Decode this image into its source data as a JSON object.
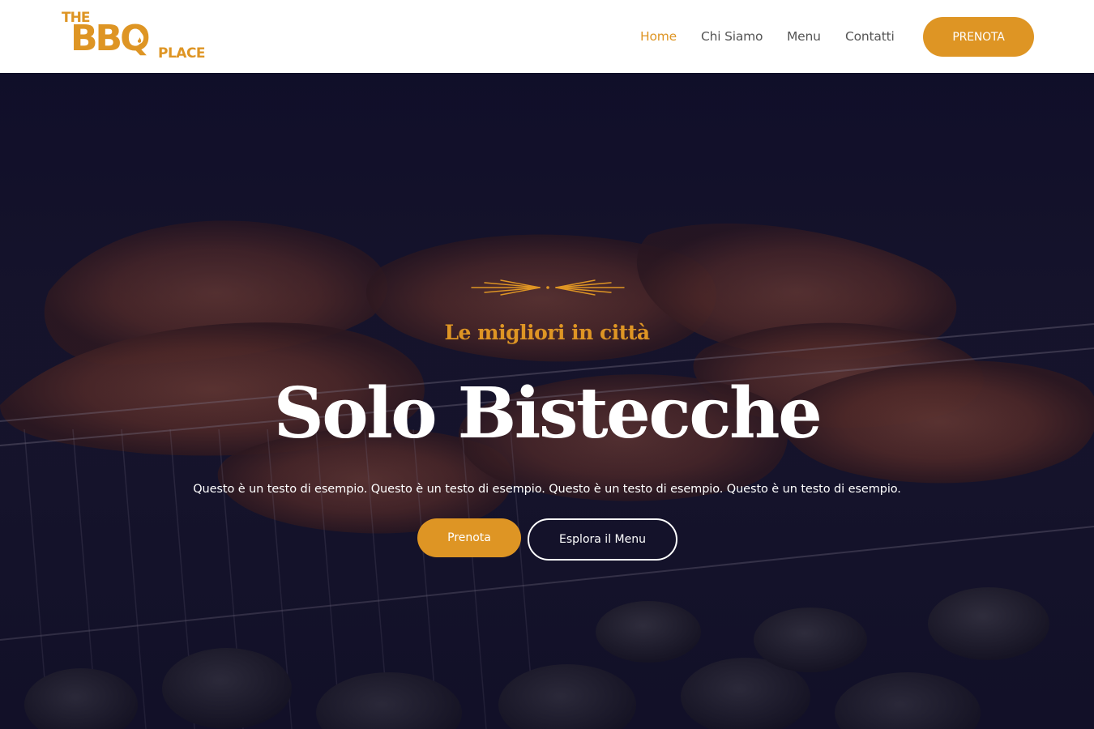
{
  "brand": {
    "logo_the": "THE",
    "logo_bbq": "BBQ",
    "logo_place": "PLACE",
    "accent_color": "#de9524"
  },
  "nav": {
    "items": [
      {
        "label": "Home",
        "active": true
      },
      {
        "label": "Chi Siamo",
        "active": false
      },
      {
        "label": "Menu",
        "active": false
      },
      {
        "label": "Contatti",
        "active": false
      }
    ],
    "cta_label": "PRENOTA"
  },
  "hero": {
    "ornament_icon": "wheat-ornament-icon",
    "tagline": "Le migliori in città",
    "headline": "Solo Bistecche",
    "subtext": "Questo è un testo di esempio. Questo è un testo di esempio. Questo è un testo di esempio. Questo è un testo di esempio.",
    "primary_button": "Prenota",
    "secondary_button": "Esplora il Menu",
    "background": "grilled-steaks-photo"
  }
}
